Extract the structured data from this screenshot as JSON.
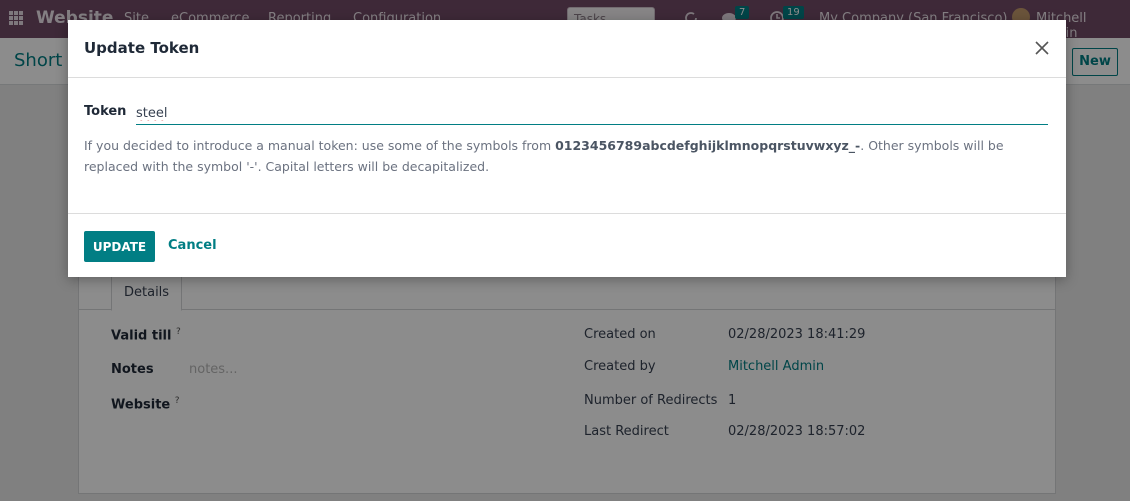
{
  "topbar": {
    "brand": "Website",
    "menu": [
      "Site",
      "eCommerce",
      "Reporting",
      "Configuration"
    ],
    "search_placeholder": "Tasks search...",
    "messages_count": "7",
    "activities_count": "19",
    "company": "My Company (San Francisco)",
    "user": "Mitchell Admin"
  },
  "subbar": {
    "breadcrumb": "Short Link",
    "new_label": "New"
  },
  "form": {
    "tab": "Details",
    "left": [
      {
        "label": "Valid till",
        "help": "?",
        "value": ""
      },
      {
        "label": "Notes",
        "help": "",
        "value": "notes..."
      },
      {
        "label": "Website",
        "help": "?",
        "value": ""
      }
    ],
    "right": [
      {
        "label": "Created on",
        "value": "02/28/2023 18:41:29"
      },
      {
        "label": "Created by",
        "value": "Mitchell Admin"
      },
      {
        "label": "Number of Redirects",
        "value": "1"
      },
      {
        "label": "Last Redirect",
        "value": "02/28/2023 18:57:02"
      }
    ]
  },
  "dialog": {
    "title": "Update Token",
    "token_label": "Token",
    "token_value": "steel",
    "help_prefix": "If you decided to introduce a manual token: use some of the symbols from ",
    "help_symbols": "0123456789abcdefghijklmnopqrstuvwxyz_-",
    "help_suffix": ". Other symbols will be replaced with the symbol '-'. Capital letters will be decapitalized.",
    "update_label": "UPDATE",
    "cancel_label": "Cancel"
  },
  "colors": {
    "topbar": "#714b67",
    "primary": "#017e84"
  }
}
